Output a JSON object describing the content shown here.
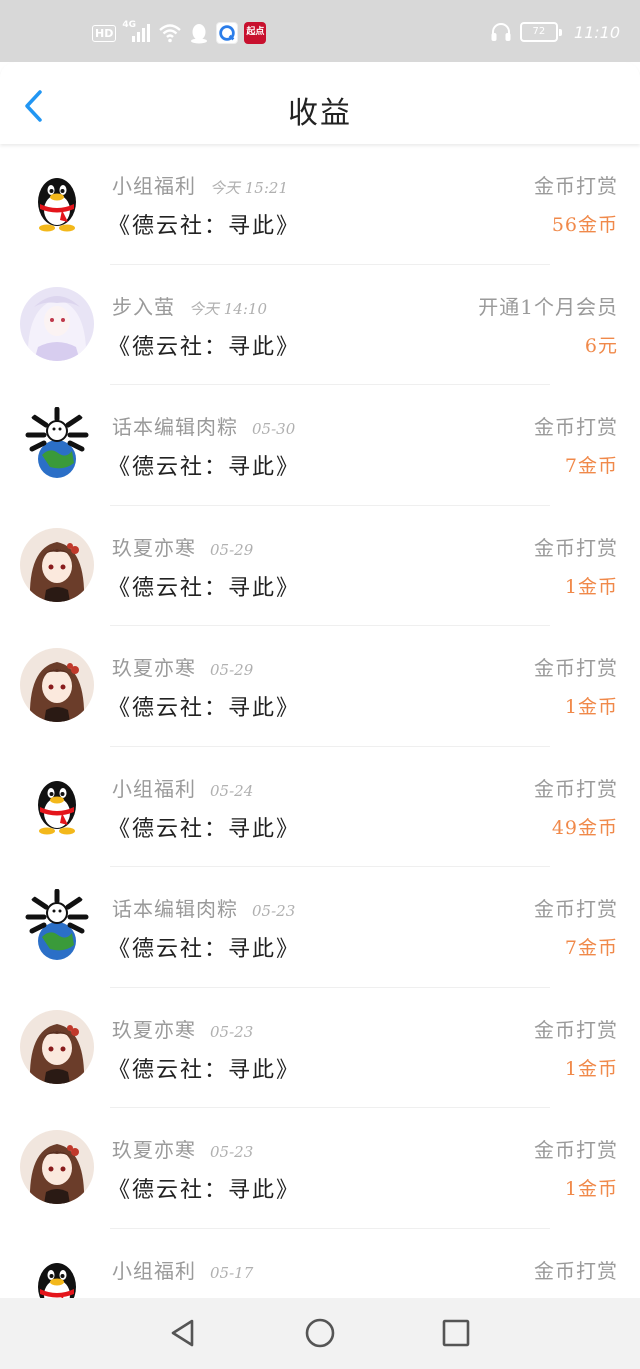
{
  "statusbar": {
    "hd": "HD",
    "network": "4G",
    "app_qd_label": "起点",
    "battery": "72",
    "time": "11:10"
  },
  "header": {
    "title": "收益"
  },
  "colors": {
    "amount": "#f0894a",
    "accent": "#2196f3"
  },
  "records": [
    {
      "avatar": "qq-penguin",
      "name": "小组福利",
      "time": "今天 15:21",
      "book": "《德云社：寻此》",
      "type": "金币打赏",
      "amount": "56金币"
    },
    {
      "avatar": "anime-girl-white",
      "name": "步入萤",
      "time": "今天 14:10",
      "book": "《德云社：寻此》",
      "type": "开通1个月会员",
      "amount": "6元"
    },
    {
      "avatar": "earth-bones",
      "name": "话本编辑肉粽",
      "time": "05-30",
      "book": "《德云社：寻此》",
      "type": "金币打赏",
      "amount": "7金币"
    },
    {
      "avatar": "anime-girl-brown",
      "name": "玖夏亦寒",
      "time": "05-29",
      "book": "《德云社：寻此》",
      "type": "金币打赏",
      "amount": "1金币"
    },
    {
      "avatar": "anime-girl-brown",
      "name": "玖夏亦寒",
      "time": "05-29",
      "book": "《德云社：寻此》",
      "type": "金币打赏",
      "amount": "1金币"
    },
    {
      "avatar": "qq-penguin",
      "name": "小组福利",
      "time": "05-24",
      "book": "《德云社：寻此》",
      "type": "金币打赏",
      "amount": "49金币"
    },
    {
      "avatar": "earth-bones",
      "name": "话本编辑肉粽",
      "time": "05-23",
      "book": "《德云社：寻此》",
      "type": "金币打赏",
      "amount": "7金币"
    },
    {
      "avatar": "anime-girl-brown",
      "name": "玖夏亦寒",
      "time": "05-23",
      "book": "《德云社：寻此》",
      "type": "金币打赏",
      "amount": "1金币"
    },
    {
      "avatar": "anime-girl-brown",
      "name": "玖夏亦寒",
      "time": "05-23",
      "book": "《德云社：寻此》",
      "type": "金币打赏",
      "amount": "1金币"
    },
    {
      "avatar": "qq-penguin",
      "name": "小组福利",
      "time": "05-17",
      "book": "",
      "type": "金币打赏",
      "amount": ""
    }
  ],
  "navbar": {
    "icons": [
      "back-triangle-icon",
      "home-circle-icon",
      "recents-square-icon"
    ]
  }
}
